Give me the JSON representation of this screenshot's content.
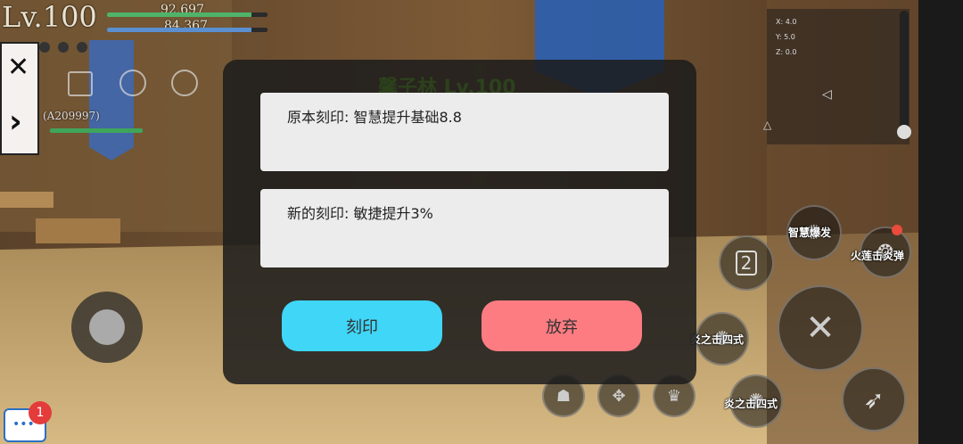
{
  "player": {
    "level": "Lv.100",
    "hp": "92,697",
    "mp": "84,367",
    "hp_fill": 0.9,
    "mp_fill": 0.9
  },
  "target": {
    "name": "馨子林 Lv.100",
    "tag": "(A209997)",
    "hp_fill": 1.0
  },
  "minimap": {
    "x": "X: 4.0",
    "y": "Y: 5.0",
    "z": "Z: 0.0"
  },
  "dialog": {
    "original_label": "原本刻印: 智慧提升基础8.8",
    "new_label": "新的刻印: 敏捷提升3%",
    "confirm": "刻印",
    "cancel": "放弃",
    "confirm_color": "#3fd6f7",
    "cancel_color": "#fc7c82"
  },
  "skills": {
    "wisdom_burst": "智慧爆发",
    "fire_lotus": "火莲击炎弹",
    "flame_strike_a": "炎之击四式",
    "flame_strike_b": "炎之击四式",
    "slot_number": "2"
  },
  "chat": {
    "badge": "1"
  }
}
